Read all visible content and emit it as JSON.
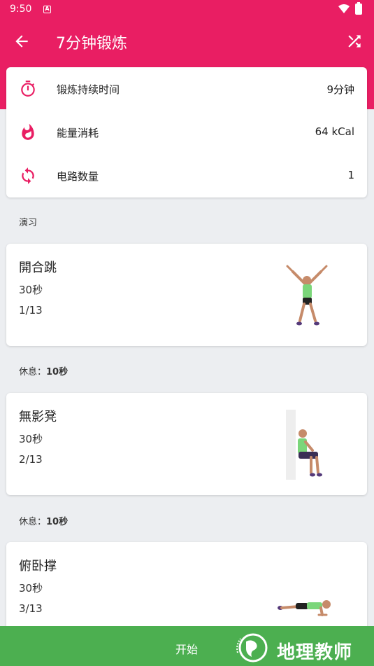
{
  "status_bar": {
    "time": "9:50",
    "notification_icon": "A"
  },
  "app_bar": {
    "title": "7分钟锻炼"
  },
  "summary": {
    "items": [
      {
        "icon": "stopwatch-icon",
        "label": "锻炼持续时间",
        "value": "9分钟"
      },
      {
        "icon": "flame-icon",
        "label": "能量消耗",
        "value": "64 kCal"
      },
      {
        "icon": "repeat-icon",
        "label": "电路数量",
        "value": "1"
      }
    ]
  },
  "section_label": "演习",
  "rest": {
    "label": "休息：",
    "duration": "10秒"
  },
  "exercises": [
    {
      "name": "開合跳",
      "duration": "30秒",
      "index": "1/13"
    },
    {
      "name": "無影凳",
      "duration": "30秒",
      "index": "2/13"
    },
    {
      "name": "俯卧撑",
      "duration": "30秒",
      "index": "3/13"
    }
  ],
  "bottom": {
    "start_label": "开始",
    "watermark": "地理教师"
  },
  "colors": {
    "primary": "#e91e63",
    "accent_green": "#4caf50",
    "background": "#eceef1"
  }
}
